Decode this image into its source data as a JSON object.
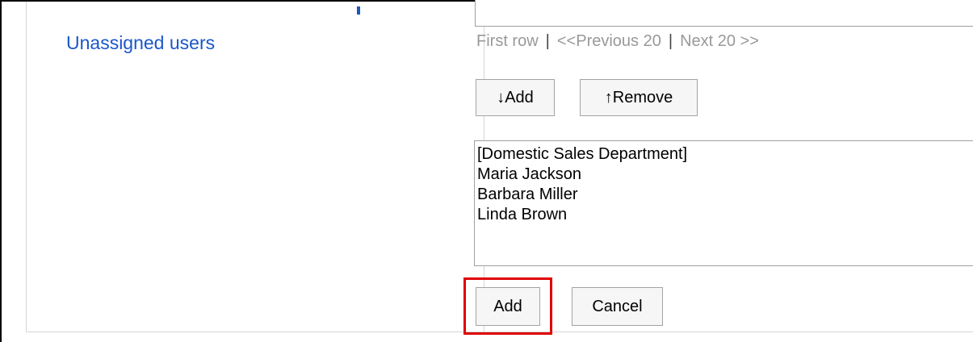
{
  "sidebar": {
    "link_label": "Unassigned users"
  },
  "pager": {
    "first": "First row",
    "separator": "|",
    "previous": "<<Previous 20",
    "next": "Next 20 >>"
  },
  "move_buttons": {
    "add_label": "↓Add",
    "remove_label": "↑Remove"
  },
  "selected_users": [
    "[Domestic Sales Department]",
    "Maria Jackson",
    "Barbara Miller",
    "Linda Brown"
  ],
  "actions": {
    "add_label": "Add",
    "cancel_label": "Cancel"
  },
  "colors": {
    "link": "#1a56c9",
    "highlight": "#e00000",
    "disabled_text": "#999999"
  }
}
